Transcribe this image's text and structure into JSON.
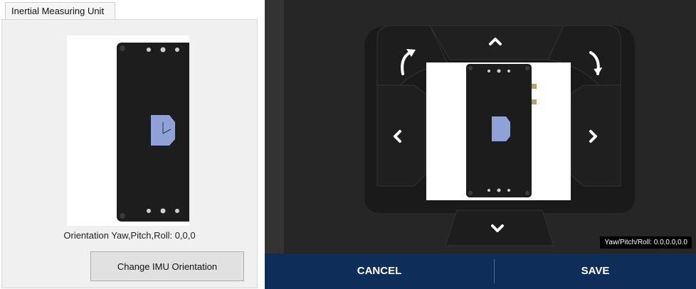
{
  "left": {
    "tab_label": "Inertial Measuring Unit",
    "orientation_text": "Orientation Yaw,Pitch,Roll: 0,0,0",
    "change_button_label": "Change IMU Orientation"
  },
  "right": {
    "readout": "Yaw/Pitch/Roll: 0.0,0.0,0.0",
    "cancel_label": "CANCEL",
    "save_label": "SAVE",
    "icons": [
      "rotate-left-icon",
      "rotate-right-icon",
      "chevron-up-icon",
      "chevron-down-icon",
      "chevron-left-icon",
      "chevron-right-icon"
    ]
  },
  "colors": {
    "dialog_bg": "#333333",
    "pad_bg": "#262626",
    "footer_bg": "#0f2d59",
    "device_body": "#1b1b1b",
    "logo_plate": "#8fa2d8"
  }
}
